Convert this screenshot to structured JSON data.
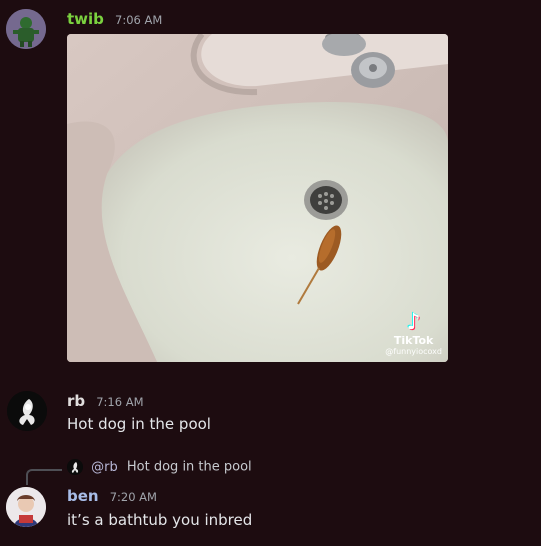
{
  "messages": [
    {
      "username": "twib",
      "time": "7:06 AM",
      "attachment": {
        "type": "video-embed",
        "overlay": {
          "icon": "tiktok-icon",
          "brand": "TikTok",
          "handle": "@funnyiocoxd"
        }
      }
    },
    {
      "username": "rb",
      "time": "7:16 AM",
      "text": "Hot dog in the pool"
    },
    {
      "username": "ben",
      "time": "7:20 AM",
      "text": "it’s a bathtub you inbred",
      "reply_to": {
        "mention": "@rb",
        "text": "Hot dog in the pool"
      }
    }
  ],
  "colors": {
    "background": "#1d0c10",
    "twib": "#7bd23f",
    "rb": "#e1dede",
    "ben": "#a8bde8",
    "timestamp": "#a0a4ab"
  }
}
